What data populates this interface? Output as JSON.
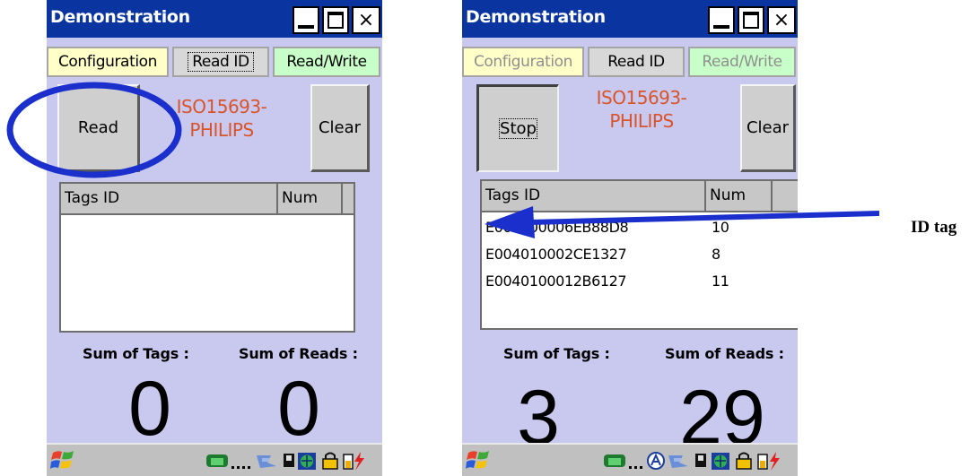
{
  "left_screen": {
    "window_title": "Demonstration",
    "close_glyph": "×",
    "tabs": [
      {
        "label": "Configuration",
        "state": "normal"
      },
      {
        "label": "Read ID",
        "state": "selected"
      },
      {
        "label": "Read/Write",
        "state": "normal"
      }
    ],
    "action_button": "Read",
    "protocol_line1": "ISO15693-",
    "protocol_line2": "PHILIPS",
    "clear_button": "Clear",
    "columns": {
      "tags": "Tags ID",
      "num": "Num"
    },
    "rows": [],
    "sum_tags_label": "Sum of Tags :",
    "sum_reads_label": "Sum of Reads :",
    "sum_tags": "0",
    "sum_reads": "0"
  },
  "right_screen": {
    "window_title": "Demonstration",
    "close_glyph": "×",
    "tabs": [
      {
        "label": "Configuration",
        "state": "disabled"
      },
      {
        "label": "Read ID",
        "state": "selected"
      },
      {
        "label": "Read/Write",
        "state": "disabled"
      }
    ],
    "action_button": "Stop",
    "protocol_line1": "ISO15693-",
    "protocol_line2": "PHILIPS",
    "clear_button": "Clear",
    "columns": {
      "tags": "Tags ID",
      "num": "Num"
    },
    "rows": [
      {
        "id": "E007000006EB88D8",
        "num": "10"
      },
      {
        "id": "E004010002CE1327",
        "num": "8"
      },
      {
        "id": "E0040100012B6127",
        "num": "11"
      }
    ],
    "sum_tags_label": "Sum of Tags :",
    "sum_reads_label": "Sum of Reads :",
    "sum_tags": "3",
    "sum_reads": "29"
  },
  "callout": {
    "label": "ID tag"
  },
  "colors": {
    "title_bar": "#0a34a0",
    "screen_bg": "#c9c9f0",
    "protocol_text": "#d9542a",
    "annotation_blue": "#1a2fcc",
    "tab_config_bg": "#ffffc8",
    "tab_rw_bg": "#c8ffc8",
    "tab_disabled_text": "#8f8f8f"
  },
  "icons": [
    "windows-start-icon",
    "phone-icon",
    "network-icon",
    "ime-icon",
    "sync-icon",
    "globe-icon",
    "lock-icon",
    "battery-icon"
  ]
}
